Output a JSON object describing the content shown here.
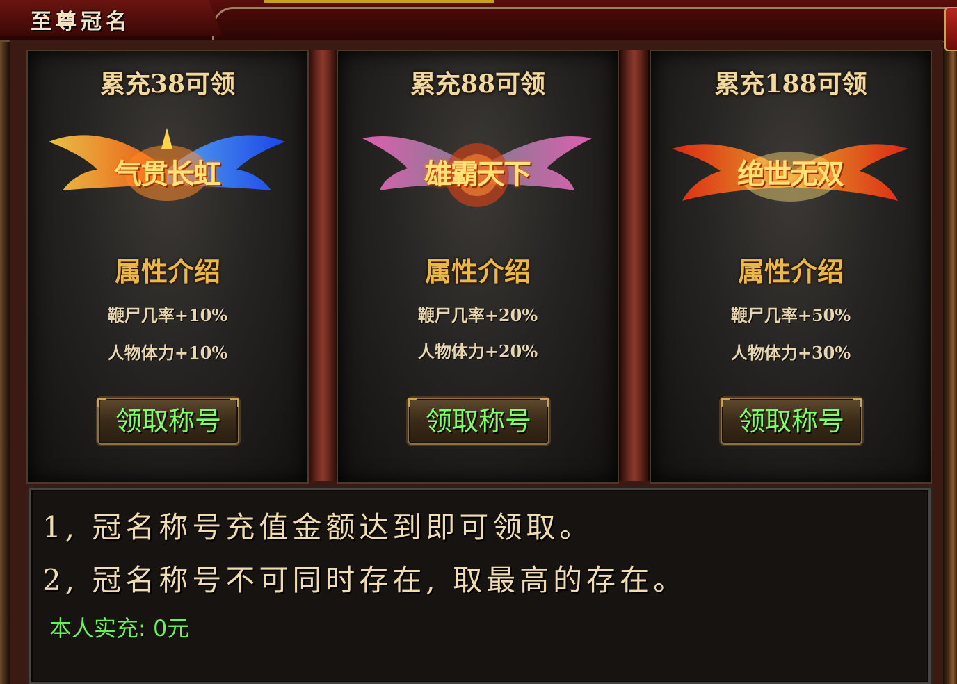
{
  "window": {
    "title": "至尊冠名"
  },
  "cards": [
    {
      "title": "累充38可领",
      "emblem_text": "气贯长虹",
      "emblem_colors": [
        "#ff7a1a",
        "#3a7aff",
        "#ffd24a"
      ],
      "attr_heading": "属性介绍",
      "attrs": [
        "鞭尸几率+10%",
        "人物体力+10%"
      ],
      "button": "领取称号"
    },
    {
      "title": "累充88可领",
      "emblem_text": "雄霸天下",
      "emblem_colors": [
        "#ff4ab0",
        "#b0b0c0",
        "#ff7a2a"
      ],
      "attr_heading": "属性介绍",
      "attrs": [
        "鞭尸几率+20%",
        "人物体力+20%"
      ],
      "button": "领取称号"
    },
    {
      "title": "累充188可领",
      "emblem_text": "绝世无双",
      "emblem_colors": [
        "#ff3a1a",
        "#ffb02a",
        "#ffe07a"
      ],
      "attr_heading": "属性介绍",
      "attrs": [
        "鞭尸几率+50%",
        "人物体力+30%"
      ],
      "button": "领取称号"
    }
  ],
  "notes": {
    "lines": [
      "1, 冠名称号充值金额达到即可领取。",
      "2, 冠名称号不可同时存在, 取最高的存在。"
    ],
    "recharge": "本人实充: 0元"
  }
}
